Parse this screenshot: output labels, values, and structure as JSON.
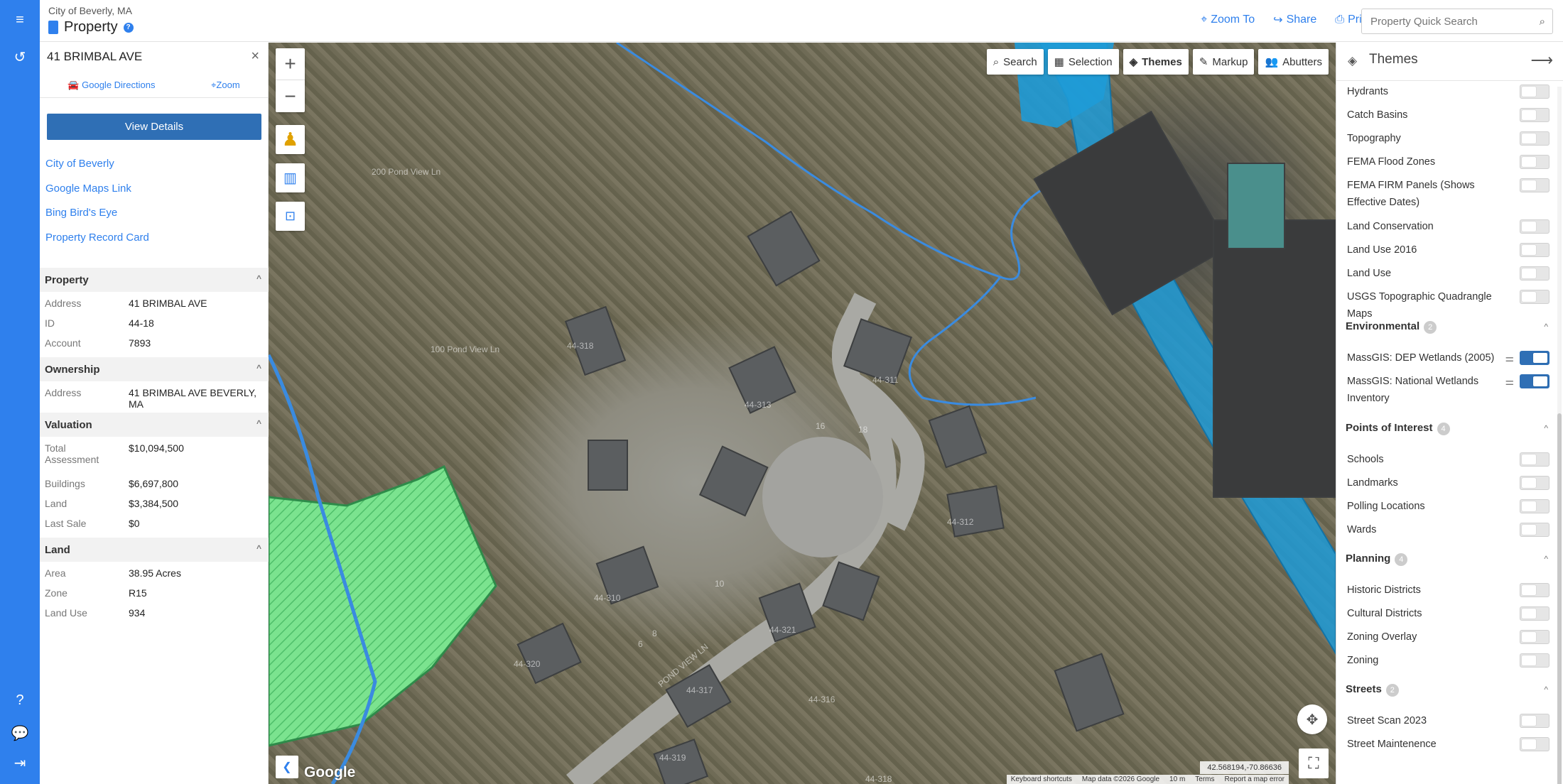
{
  "header": {
    "city": "City of Beverly, MA",
    "app_title": "Property",
    "links": {
      "zoom_to": "Zoom To",
      "share": "Share",
      "print": "Print"
    },
    "search_placeholder": "Property Quick Search"
  },
  "property_panel": {
    "address_title": "41 BRIMBAL AVE",
    "google_directions": "Google Directions",
    "zoom": "Zoom",
    "view_details": "View Details",
    "links": [
      "City of Beverly",
      "Google Maps Link",
      "Bing Bird's Eye",
      "Property Record Card"
    ],
    "sections": {
      "property": {
        "title": "Property",
        "rows": [
          {
            "key": "Address",
            "value": "41 BRIMBAL AVE"
          },
          {
            "key": "ID",
            "value": "44-18"
          },
          {
            "key": "Account",
            "value": "7893"
          }
        ]
      },
      "ownership": {
        "title": "Ownership",
        "rows": [
          {
            "key": "Address",
            "value": "41 BRIMBAL AVE BEVERLY, MA"
          }
        ]
      },
      "valuation": {
        "title": "Valuation",
        "rows": [
          {
            "key": "Total Assessment",
            "value": "$10,094,500"
          },
          {
            "key": "Buildings",
            "value": "$6,697,800"
          },
          {
            "key": "Land",
            "value": "$3,384,500"
          },
          {
            "key": "Last Sale",
            "value": "$0"
          }
        ]
      },
      "land": {
        "title": "Land",
        "rows": [
          {
            "key": "Area",
            "value": "38.95 Acres"
          },
          {
            "key": "Zone",
            "value": "R15"
          },
          {
            "key": "Land Use",
            "value": "934"
          }
        ]
      }
    }
  },
  "map": {
    "tools": [
      "Search",
      "Selection",
      "Themes",
      "Markup",
      "Abutters"
    ],
    "active_tool": "Themes",
    "coordinates": "42.568194,-70.86636",
    "attribution": [
      "Keyboard shortcuts",
      "Map data ©2026 Google",
      "10 m",
      "Terms",
      "Report a map error"
    ],
    "google_logo": "Google",
    "labels": [
      "200 Pond View Ln",
      "100 Pond View Ln",
      "44-318",
      "44-313",
      "44-311",
      "44-312",
      "44-310",
      "44-321",
      "44-320",
      "44-319",
      "44-317",
      "44-316",
      "16",
      "18",
      "10",
      "8",
      "6",
      "POND VIEW LN",
      "44-318"
    ]
  },
  "themes_panel": {
    "title": "Themes",
    "top_items": [
      {
        "label": "Hydrants",
        "on": false
      },
      {
        "label": "Catch Basins",
        "on": false
      },
      {
        "label": "Topography",
        "on": false
      },
      {
        "label": "FEMA Flood Zones",
        "on": false
      },
      {
        "label": "FEMA FIRM Panels (Shows Effective Dates)",
        "on": false
      },
      {
        "label": "Land Conservation",
        "on": false
      },
      {
        "label": "Land Use 2016",
        "on": false
      },
      {
        "label": "Land Use",
        "on": false
      },
      {
        "label": "USGS Topographic Quadrangle Maps",
        "on": false
      }
    ],
    "groups": [
      {
        "name": "Environmental",
        "count": "2",
        "items": [
          {
            "label": "MassGIS: DEP Wetlands (2005)",
            "on": true
          },
          {
            "label": "MassGIS: National Wetlands Inventory",
            "on": true
          }
        ]
      },
      {
        "name": "Points of Interest",
        "count": "4",
        "items": [
          {
            "label": "Schools",
            "on": false
          },
          {
            "label": "Landmarks",
            "on": false
          },
          {
            "label": "Polling Locations",
            "on": false
          },
          {
            "label": "Wards",
            "on": false
          }
        ]
      },
      {
        "name": "Planning",
        "count": "4",
        "items": [
          {
            "label": "Historic Districts",
            "on": false
          },
          {
            "label": "Cultural Districts",
            "on": false
          },
          {
            "label": "Zoning Overlay",
            "on": false
          },
          {
            "label": "Zoning",
            "on": false
          }
        ]
      },
      {
        "name": "Streets",
        "count": "2",
        "items": [
          {
            "label": "Street Scan 2023",
            "on": false
          },
          {
            "label": "Street Maintenence",
            "on": false
          }
        ]
      }
    ]
  },
  "colors": {
    "accent": "#2f80ed",
    "button": "#2f6fb5",
    "wetland": "#1e9bd7",
    "conservation": "#7be38f"
  }
}
